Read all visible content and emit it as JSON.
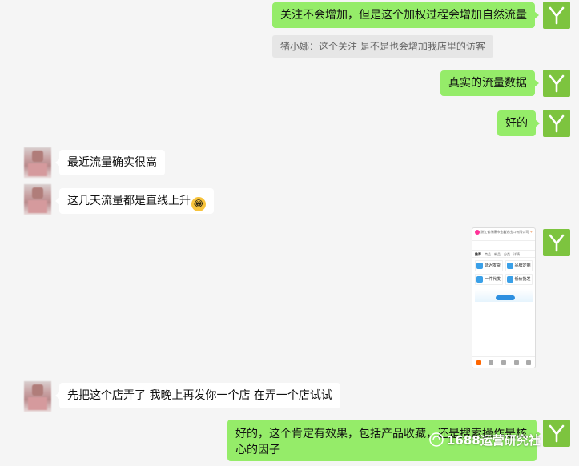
{
  "messages": {
    "m1": "关注不会增加，但是这个加权过程会增加自然流量",
    "quote": "猪小娜：这个关注 是不是也会增加我店里的访客",
    "m2": "真实的流量数据",
    "m3": "好的",
    "m4": "最近流量确实很高",
    "m5": "这几天流量都是直线上升",
    "m6": "先把这个店弄了  我晚上再发你一个店  在弄一个店试试",
    "m7_line1": "好的，这个肯定有效果，包括产品收藏，还是搜索操作是核",
    "m7_line2": "心的因子"
  },
  "image_message": {
    "store_name": "浙江省永康市金鑫进出口有限公司",
    "tabs": [
      "推荐",
      "商品",
      "新品",
      "分类",
      "详情"
    ],
    "cells": [
      "延迟发货",
      "品牌定制",
      "一件代发",
      "低价批发"
    ]
  },
  "watermark": "1688运营研究社",
  "colors": {
    "sent_bubble": "#95ec69",
    "received_bubble": "#ffffff",
    "background": "#f5f5f5",
    "avatar_brand": "#7dc43f"
  }
}
